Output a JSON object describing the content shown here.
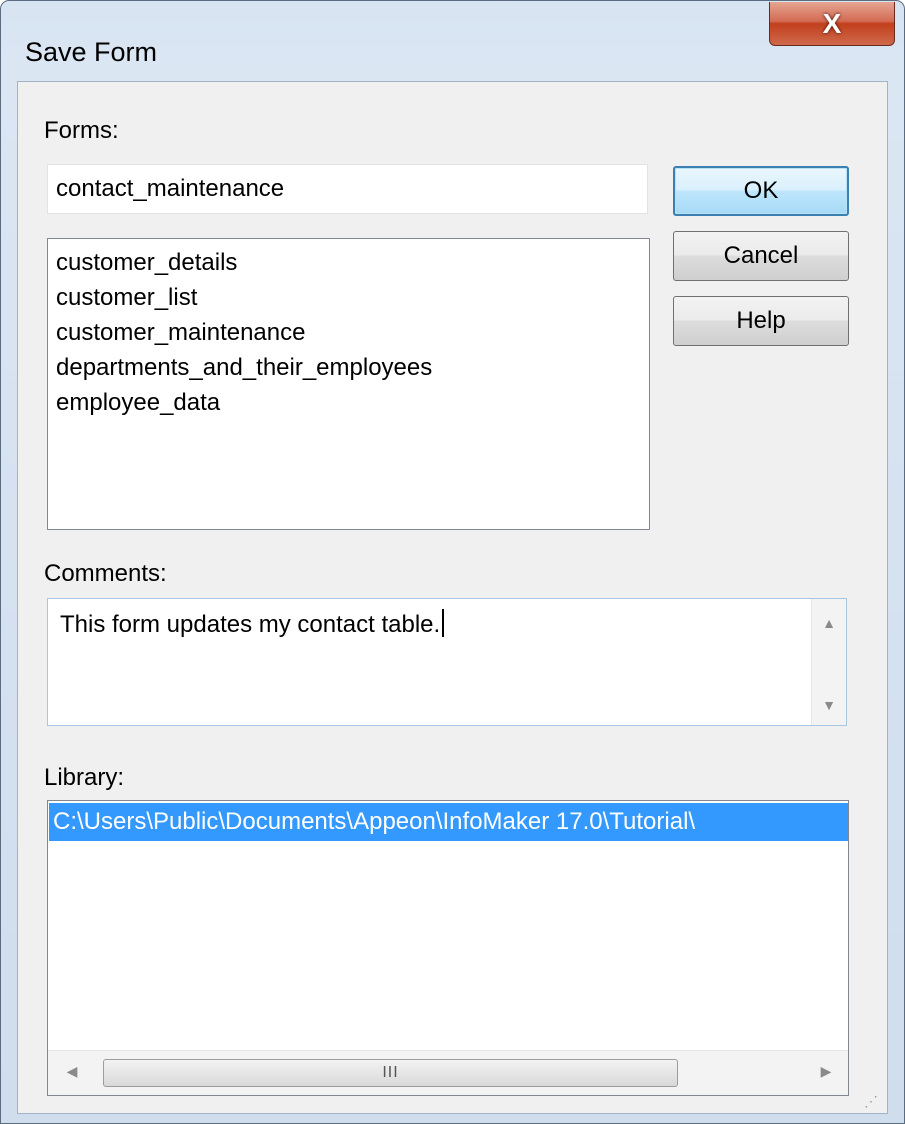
{
  "window": {
    "title": "Save Form",
    "close_label": "X"
  },
  "forms": {
    "label": "Forms:",
    "value": "contact_maintenance",
    "items": [
      "customer_details",
      "customer_list",
      "customer_maintenance",
      "departments_and_their_employees",
      "employee_data"
    ]
  },
  "buttons": {
    "ok": "OK",
    "cancel": "Cancel",
    "help": "Help"
  },
  "comments": {
    "label": "Comments:",
    "value": "This form updates my contact table."
  },
  "library": {
    "label": "Library:",
    "selected_path": "C:\\Users\\Public\\Documents\\Appeon\\InfoMaker 17.0\\Tutorial\\",
    "hscroll_thumb_label": "III"
  },
  "icons": {
    "up_arrow": "▲",
    "down_arrow": "▼",
    "left_arrow": "◀",
    "right_arrow": "▶",
    "resize_grip": "⋰"
  },
  "colors": {
    "selection": "#3399ff",
    "default_button_border": "#3c7fb1",
    "close_button": "#c23f1c"
  }
}
